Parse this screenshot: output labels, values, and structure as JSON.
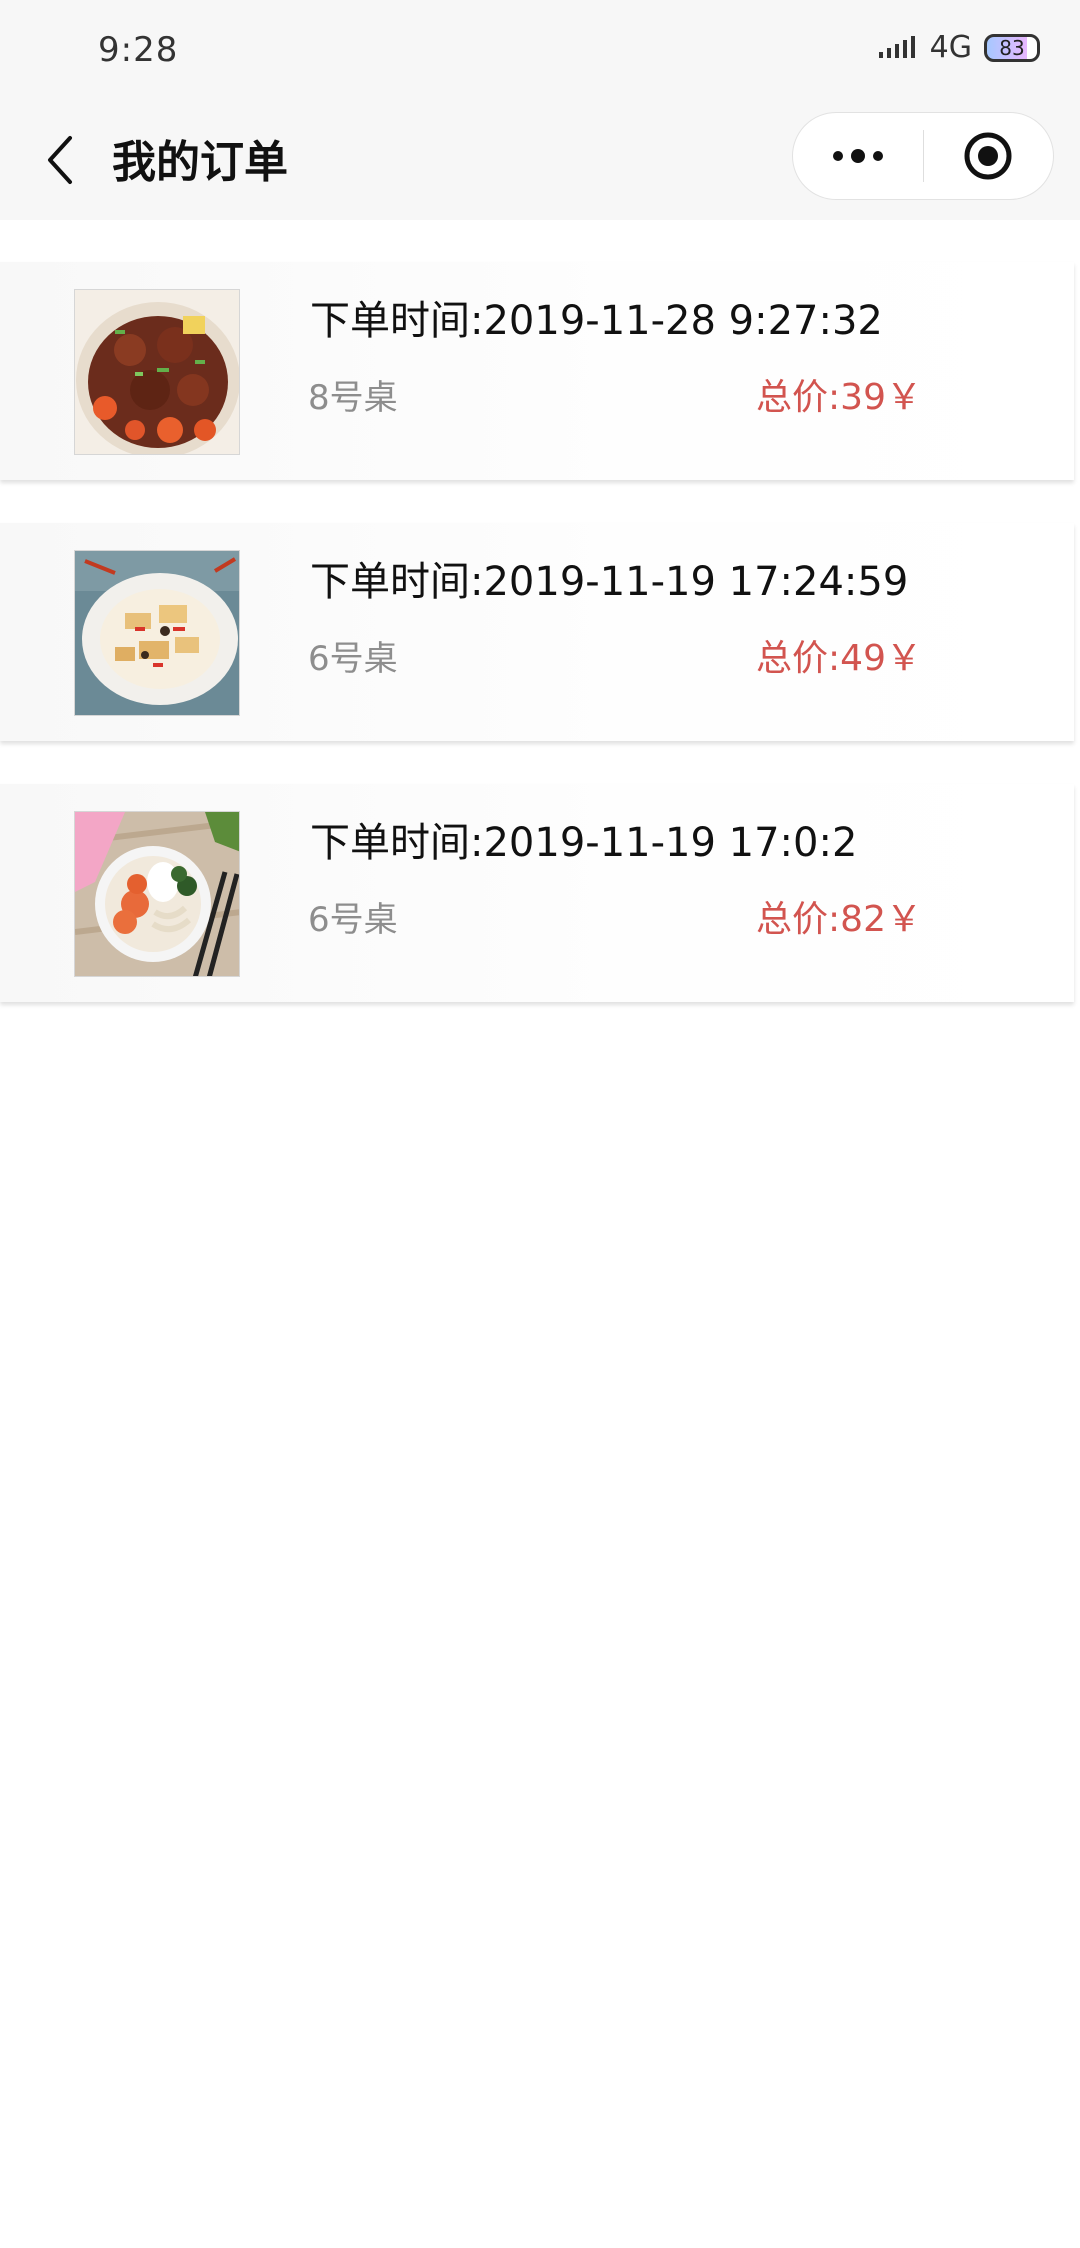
{
  "status_bar": {
    "time": "9:28",
    "network": "4G",
    "battery": "83"
  },
  "nav": {
    "title": "我的订单"
  },
  "orders": [
    {
      "time": "下单时间:2019-11-28 9:27:32",
      "table": "8号桌",
      "total": "总价:39￥"
    },
    {
      "time": "下单时间:2019-11-19 17:24:59",
      "table": "6号桌",
      "total": "总价:49￥"
    },
    {
      "time": "下单时间:2019-11-19 17:0:2",
      "table": "6号桌",
      "total": "总价:82￥"
    }
  ],
  "colors": {
    "price": "#d2544f",
    "table_text": "#8d8d8d",
    "bar_background": "#f7f7f7"
  }
}
